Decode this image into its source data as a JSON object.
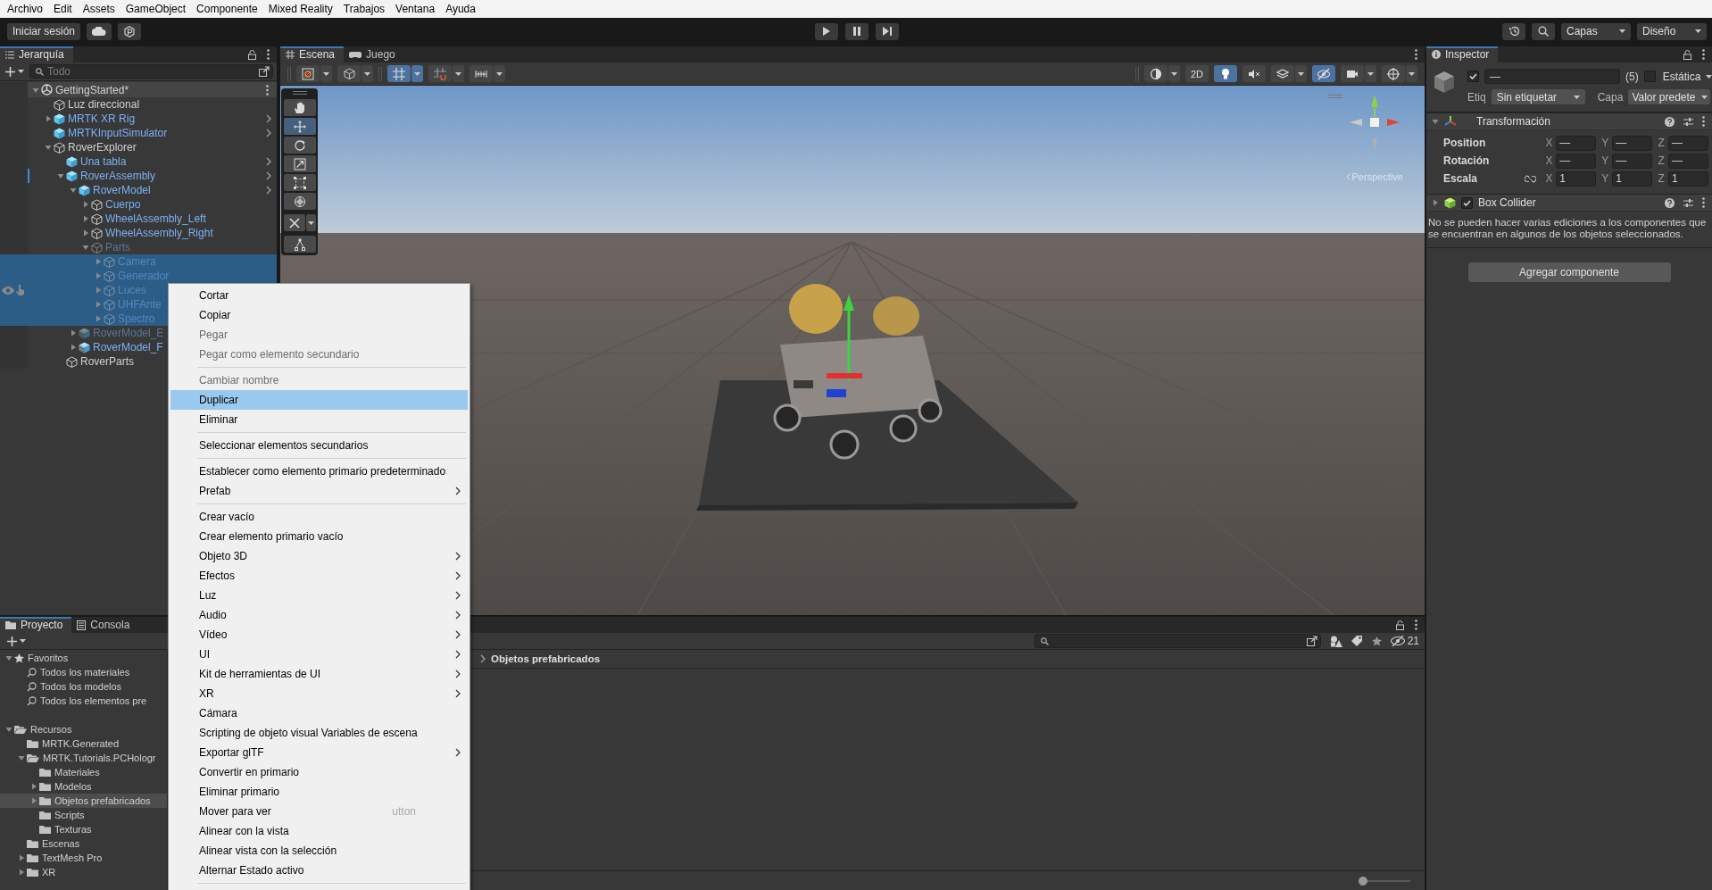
{
  "menu_bar": [
    "Archivo",
    "Edit",
    "Assets",
    "GameObject",
    "Componente",
    "Mixed Reality",
    "Trabajos",
    "Ventana",
    "Ayuda"
  ],
  "toolbar": {
    "sign_in": "Iniciar sesión",
    "layers": "Capas",
    "layout": "Diseño"
  },
  "hierarchy": {
    "tab": "Jerarquía",
    "search_placeholder": "Todo",
    "scene": {
      "label": "GettingStarted*",
      "expanded": true
    },
    "items": [
      {
        "label": "Luz direccional",
        "kind": "gameobject",
        "active": true,
        "selected": false,
        "hovered": false,
        "overridden": false
      },
      {
        "label": "MRTK XR Rig",
        "kind": "prefab",
        "active": true,
        "selected": false,
        "hovered": false,
        "overridden": false,
        "expanded": false
      },
      {
        "label": "MRTKInputSimulator",
        "kind": "prefab",
        "active": true,
        "selected": false,
        "hovered": false,
        "overridden": false
      },
      {
        "label": "RoverExplorer",
        "kind": "gameobject",
        "active": true,
        "selected": false,
        "hovered": false,
        "overridden": false,
        "expanded": true,
        "children": [
          {
            "label": "Una tabla",
            "kind": "prefab",
            "active": true,
            "selected": false,
            "hovered": false,
            "overridden": false
          },
          {
            "label": "RoverAssembly",
            "kind": "prefab",
            "active": true,
            "selected": false,
            "hovered": false,
            "overridden": true,
            "expanded": true,
            "children": [
              {
                "label": "RoverModel",
                "kind": "prefab",
                "active": true,
                "selected": false,
                "hovered": false,
                "overridden": false,
                "expanded": true,
                "children": [
                  {
                    "label": "Cuerpo",
                    "kind": "prefab_child",
                    "active": true,
                    "selected": false,
                    "hovered": false,
                    "overridden": false,
                    "expanded": false
                  },
                  {
                    "label": "WheelAssembly_Left",
                    "kind": "prefab_child",
                    "active": true,
                    "selected": false,
                    "hovered": false,
                    "overridden": false,
                    "expanded": false
                  },
                  {
                    "label": "WheelAssembly_Right",
                    "kind": "prefab_child",
                    "active": true,
                    "selected": false,
                    "hovered": false,
                    "overridden": false,
                    "expanded": false
                  },
                  {
                    "label": "Parts",
                    "kind": "prefab_child",
                    "active": false,
                    "selected": false,
                    "hovered": false,
                    "overridden": false,
                    "expanded": true,
                    "children": [
                      {
                        "label": "Camera",
                        "kind": "prefab_child",
                        "active": false,
                        "selected": true,
                        "hovered": false,
                        "overridden": false,
                        "expanded": false
                      },
                      {
                        "label": "Generador",
                        "kind": "prefab_child",
                        "active": false,
                        "selected": true,
                        "hovered": false,
                        "overridden": false,
                        "expanded": false
                      },
                      {
                        "label": "Luces",
                        "kind": "prefab_child",
                        "active": false,
                        "selected": true,
                        "hovered": true,
                        "overridden": false,
                        "expanded": false
                      },
                      {
                        "label": "UHFAnte",
                        "kind": "prefab_child",
                        "active": false,
                        "selected": true,
                        "hovered": false,
                        "overridden": false,
                        "expanded": false
                      },
                      {
                        "label": "Spectro",
                        "kind": "prefab_child",
                        "active": false,
                        "selected": true,
                        "hovered": false,
                        "overridden": false,
                        "expanded": false
                      }
                    ]
                  }
                ]
              },
              {
                "label": "RoverModel_E",
                "kind": "prefab_variant",
                "active": false,
                "selected": false,
                "hovered": false,
                "overridden": false,
                "expanded": false
              },
              {
                "label": "RoverModel_F",
                "kind": "prefab_variant",
                "active": true,
                "selected": false,
                "hovered": false,
                "overridden": false,
                "expanded": false
              }
            ]
          },
          {
            "label": "RoverParts",
            "kind": "gameobject",
            "active": true,
            "selected": false,
            "hovered": false,
            "overridden": false
          }
        ]
      }
    ]
  },
  "scene_view": {
    "tabs": [
      {
        "label": "Escena",
        "kind": "scene",
        "selected": true
      },
      {
        "label": "Juego",
        "kind": "game",
        "selected": false
      }
    ],
    "left_buttons": [
      {
        "kind": "pivot",
        "on": false,
        "dropdown": true
      },
      {
        "kind": "cube",
        "on": false,
        "dropdown": true
      },
      {
        "kind": "grid",
        "on": true,
        "dropdown": true
      },
      {
        "kind": "snap",
        "on": false,
        "dropdown": true
      },
      {
        "kind": "ruler",
        "on": false,
        "dropdown": true
      }
    ],
    "right_buttons": [
      {
        "kind": "shading",
        "on": false,
        "dropdown": true
      },
      {
        "kind": "text",
        "label": "2D",
        "on": false,
        "dropdown": false
      },
      {
        "kind": "light",
        "on": true,
        "dropdown": false
      },
      {
        "kind": "audio",
        "on": false,
        "dropdown": false
      },
      {
        "kind": "effects",
        "on": false,
        "dropdown": true
      },
      {
        "kind": "visibility",
        "on": true,
        "dropdown": false
      },
      {
        "kind": "camera",
        "on": false,
        "dropdown": true
      },
      {
        "kind": "gizmos",
        "on": false,
        "dropdown": true
      }
    ],
    "tools": [
      {
        "kind": "hand",
        "selected": false
      },
      {
        "kind": "move",
        "selected": true
      },
      {
        "kind": "rotate",
        "selected": false
      },
      {
        "kind": "scale",
        "selected": false
      },
      {
        "kind": "rect",
        "selected": false
      },
      {
        "kind": "transform",
        "selected": false
      }
    ],
    "perspective_label": "Perspective"
  },
  "inspector": {
    "tab": "Inspector",
    "enabled": true,
    "name_value": "—",
    "count": "(5)",
    "static_checked": false,
    "static_label": "Estática",
    "tag_label": "Etiq",
    "tag_value": "Sin etiquetar",
    "layer_label": "Capa",
    "layer_value": "Valor predete",
    "components": [
      {
        "kind": "transform",
        "title": "Transformación",
        "expanded": true,
        "rows": [
          {
            "label": "Position",
            "kind": "vector",
            "fields": [
              {
                "axis": "X",
                "value": "—"
              },
              {
                "axis": "Y",
                "value": "—"
              },
              {
                "axis": "Z",
                "value": "—"
              }
            ]
          },
          {
            "label": "Rotación",
            "kind": "vector",
            "fields": [
              {
                "axis": "X",
                "value": "—"
              },
              {
                "axis": "Y",
                "value": "—"
              },
              {
                "axis": "Z",
                "value": "—"
              }
            ]
          },
          {
            "label": "Escala",
            "kind": "scale",
            "fields": [
              {
                "axis": "X",
                "value": "1"
              },
              {
                "axis": "Y",
                "value": "1"
              },
              {
                "axis": "Z",
                "value": "1"
              }
            ]
          }
        ]
      },
      {
        "kind": "collider",
        "title": "Box Collider",
        "expanded": false,
        "enabled": true
      }
    ],
    "message": "No se pueden hacer varias ediciones a los componentes que se encuentran en algunos de los objetos seleccionados.",
    "add_button": "Agregar componente"
  },
  "project": {
    "tabs": [
      {
        "label": "Proyecto",
        "kind": "project",
        "selected": true
      },
      {
        "label": "Consola",
        "kind": "console",
        "selected": false
      }
    ],
    "tree": [
      {
        "label": "Favoritos",
        "kind": "favorites",
        "expanded": true,
        "selected": false,
        "children": [
          {
            "label": "Todos los materiales",
            "kind": "search",
            "selected": false
          },
          {
            "label": "Todos los modelos",
            "kind": "search",
            "selected": false
          },
          {
            "label": "Todos los elementos pre",
            "kind": "search",
            "selected": false
          }
        ]
      },
      {
        "label": "Recursos",
        "kind": "folder",
        "expanded": true,
        "selected": false,
        "children": [
          {
            "label": "MRTK.Generated",
            "kind": "folder",
            "selected": false
          },
          {
            "label": "MRTK.Tutorials.PCHologr",
            "kind": "folder",
            "expanded": true,
            "selected": false,
            "children": [
              {
                "label": "Materiales",
                "kind": "folder",
                "selected": false
              },
              {
                "label": "Modelos",
                "kind": "folder",
                "expanded": false,
                "selected": false
              },
              {
                "label": "Objetos prefabricados",
                "kind": "folder",
                "expanded": false,
                "selected": true
              },
              {
                "label": "Scripts",
                "kind": "folder",
                "selected": false
              },
              {
                "label": "Texturas",
                "kind": "folder",
                "selected": false
              }
            ]
          },
          {
            "label": "Escenas",
            "kind": "folder",
            "selected": false
          },
          {
            "label": "TextMesh Pro",
            "kind": "folder",
            "expanded": false,
            "selected": false
          },
          {
            "label": "XR",
            "kind": "folder",
            "expanded": false,
            "selected": false
          }
        ]
      }
    ],
    "breadcrumb": [
      "Objetos prefabricados"
    ],
    "hidden_count": "21",
    "zoom_slider": {
      "level": 0
    }
  },
  "context_menu": {
    "items": [
      {
        "kind": "item",
        "label": "Cortar",
        "disabled": false,
        "selected": false,
        "submenu": false
      },
      {
        "kind": "item",
        "label": "Copiar",
        "disabled": false,
        "selected": false,
        "submenu": false
      },
      {
        "kind": "item",
        "label": "Pegar",
        "disabled": true,
        "selected": false,
        "submenu": false
      },
      {
        "kind": "item",
        "label": "Pegar como elemento secundario",
        "disabled": true,
        "selected": false,
        "submenu": false
      },
      {
        "kind": "separator"
      },
      {
        "kind": "item",
        "label": "Cambiar nombre",
        "disabled": true,
        "selected": false,
        "submenu": false
      },
      {
        "kind": "item",
        "label": "Duplicar",
        "disabled": false,
        "selected": true,
        "submenu": false
      },
      {
        "kind": "item",
        "label": "Eliminar",
        "disabled": false,
        "selected": false,
        "submenu": false
      },
      {
        "kind": "separator"
      },
      {
        "kind": "item",
        "label": "Seleccionar elementos secundarios",
        "disabled": false,
        "selected": false,
        "submenu": false
      },
      {
        "kind": "separator"
      },
      {
        "kind": "item",
        "label": "Establecer como elemento primario predeterminado",
        "disabled": false,
        "selected": false,
        "submenu": false
      },
      {
        "kind": "item",
        "label": "Prefab",
        "disabled": false,
        "selected": false,
        "submenu": true
      },
      {
        "kind": "separator"
      },
      {
        "kind": "item",
        "label": "Crear vacío",
        "disabled": false,
        "selected": false,
        "submenu": false
      },
      {
        "kind": "item",
        "label": "Crear elemento primario vacío",
        "disabled": false,
        "selected": false,
        "submenu": false
      },
      {
        "kind": "item",
        "label": "Objeto 3D",
        "disabled": false,
        "selected": false,
        "submenu": true
      },
      {
        "kind": "item",
        "label": "Efectos",
        "disabled": false,
        "selected": false,
        "submenu": true
      },
      {
        "kind": "item",
        "label": "Luz",
        "disabled": false,
        "selected": false,
        "submenu": true
      },
      {
        "kind": "item",
        "label": "Audio",
        "disabled": false,
        "selected": false,
        "submenu": true
      },
      {
        "kind": "item",
        "label": "Vídeo",
        "disabled": false,
        "selected": false,
        "submenu": true
      },
      {
        "kind": "item",
        "label": "UI",
        "disabled": false,
        "selected": false,
        "submenu": true
      },
      {
        "kind": "item",
        "label": "Kit de herramientas de UI",
        "disabled": false,
        "selected": false,
        "submenu": true
      },
      {
        "kind": "item",
        "label": "XR",
        "disabled": false,
        "selected": false,
        "submenu": true
      },
      {
        "kind": "item",
        "label": "Cámara",
        "disabled": false,
        "selected": false,
        "submenu": false
      },
      {
        "kind": "item",
        "label": "Scripting de objeto visual Variables de escena",
        "disabled": false,
        "selected": false,
        "submenu": false
      },
      {
        "kind": "item",
        "label": "Exportar glTF",
        "disabled": false,
        "selected": false,
        "submenu": true
      },
      {
        "kind": "item",
        "label": "Convertir en primario",
        "disabled": false,
        "selected": false,
        "submenu": false
      },
      {
        "kind": "item",
        "label": "Eliminar primario",
        "disabled": false,
        "selected": false,
        "submenu": false
      },
      {
        "kind": "item",
        "label": "Mover para ver",
        "disabled": false,
        "selected": false,
        "submenu": false,
        "ghost_text": "utton"
      },
      {
        "kind": "item",
        "label": "Alinear con la vista",
        "disabled": false,
        "selected": false,
        "submenu": false
      },
      {
        "kind": "item",
        "label": "Alinear vista con la selección",
        "disabled": false,
        "selected": false,
        "submenu": false
      },
      {
        "kind": "item",
        "label": "Alternar Estado activo",
        "disabled": false,
        "selected": false,
        "submenu": false
      },
      {
        "kind": "separator"
      }
    ]
  }
}
